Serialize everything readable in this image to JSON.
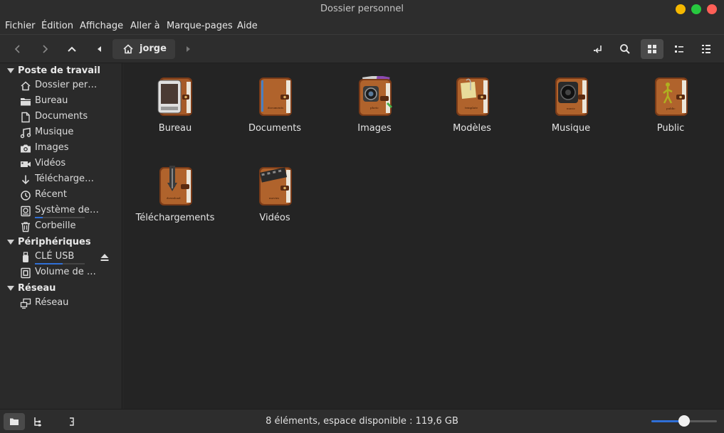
{
  "window": {
    "title": "Dossier personnel",
    "buttons": {
      "minimize": "#f5b800",
      "maximize": "#27c93f",
      "close": "#ff5f57"
    }
  },
  "menu": [
    "Fichier",
    "Édition",
    "Affichage",
    "Aller à",
    "Marque-pages",
    "Aide"
  ],
  "toolbar": {
    "location": "jorge",
    "icons": [
      "back-icon",
      "forward-icon",
      "up-icon",
      "path-left-icon",
      "home-icon",
      "path-right-icon",
      "toggle-location-icon",
      "search-icon",
      "icon-view-icon",
      "list-view-icon",
      "compact-view-icon"
    ]
  },
  "sidebar": {
    "sections": [
      {
        "title": "Poste de travail",
        "items": [
          {
            "label": "Dossier per…",
            "icon": "home-icon"
          },
          {
            "label": "Bureau",
            "icon": "folder-icon"
          },
          {
            "label": "Documents",
            "icon": "document-icon"
          },
          {
            "label": "Musique",
            "icon": "music-icon"
          },
          {
            "label": "Images",
            "icon": "camera-icon"
          },
          {
            "label": "Vidéos",
            "icon": "video-icon"
          },
          {
            "label": "Télécharge…",
            "icon": "download-icon"
          },
          {
            "label": "Récent",
            "icon": "clock-icon"
          },
          {
            "label": "Système de…",
            "icon": "drive-icon",
            "usage": 0.15
          },
          {
            "label": "Corbeille",
            "icon": "trash-icon"
          }
        ]
      },
      {
        "title": "Périphériques",
        "items": [
          {
            "label": "CLÉ USB",
            "icon": "usb-icon",
            "usage": 0.55,
            "eject": true
          },
          {
            "label": "Volume de …",
            "icon": "drive-icon"
          }
        ]
      },
      {
        "title": "Réseau",
        "items": [
          {
            "label": "Réseau",
            "icon": "network-icon"
          }
        ]
      }
    ]
  },
  "files": [
    {
      "name": "Bureau",
      "icon": "folder-desktop-icon"
    },
    {
      "name": "Documents",
      "icon": "folder-documents-icon"
    },
    {
      "name": "Images",
      "icon": "folder-pictures-icon"
    },
    {
      "name": "Modèles",
      "icon": "folder-templates-icon"
    },
    {
      "name": "Musique",
      "icon": "folder-music-icon"
    },
    {
      "name": "Public",
      "icon": "folder-public-icon"
    },
    {
      "name": "Téléchargements",
      "icon": "folder-download-icon"
    },
    {
      "name": "Vidéos",
      "icon": "folder-videos-icon"
    }
  ],
  "status": {
    "text": "8 éléments, espace disponible : 119,6 GB",
    "zoom": 0.5,
    "accent": "#2f6fd6"
  }
}
